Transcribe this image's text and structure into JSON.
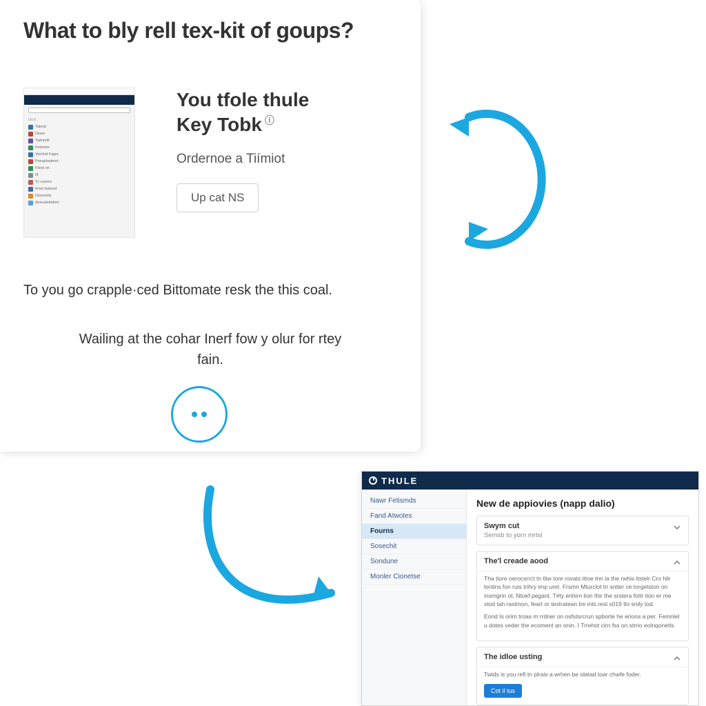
{
  "colors": {
    "accent": "#1ba7e0",
    "navy": "#0f2a4a",
    "primary_btn": "#1c7ed6"
  },
  "top": {
    "title": "What to bly rell tex-kit of goups?",
    "hero_line1": "You tfole thule",
    "hero_line2": "Key Tobk",
    "hero_sub": "Ordernoe a Tiímiot",
    "hero_btn": "Up cat NS",
    "para1": "To you go crapple·ced Bittomate resk the this coal.",
    "para2": "Wailing at the cohar Inerf fow y olur for rtey fain."
  },
  "mini": {
    "section1": "Occs",
    "items": [
      {
        "label": "Tabcal",
        "color": "#3b6ea5"
      },
      {
        "label": "Diuse",
        "color": "#b84a3a"
      },
      {
        "label": "Tadnorlit",
        "color": "#6a4fa0"
      },
      {
        "label": "Inntoshs",
        "color": "#2f8f5b"
      },
      {
        "label": "Verclod Fagrs",
        "color": "#3b6ea5"
      },
      {
        "label": "Fneuplostomt",
        "color": "#b84a3a"
      },
      {
        "label": "Flesk on",
        "color": "#2f8f5b"
      },
      {
        "label": "III",
        "color": "#8a8a8a"
      },
      {
        "label": "Ty conres",
        "color": "#c0585b"
      },
      {
        "label": "Innst tsatrsut",
        "color": "#3b6ea5"
      },
      {
        "label": "Disovsnly",
        "color": "#d48b2e"
      },
      {
        "label": "Anscatslodnre",
        "color": "#5aa0c8"
      }
    ]
  },
  "app": {
    "brand": "THULE",
    "sidenav": [
      {
        "label": "Nawr Fetismds"
      },
      {
        "label": "Fand Atwotes"
      },
      {
        "label": "Fourns",
        "active": true
      },
      {
        "label": "Sosechit"
      },
      {
        "label": "Sondune"
      },
      {
        "label": "Monler Cionetse"
      }
    ],
    "main_title": "New de appiovies (napp dalio)",
    "acc": [
      {
        "title": "Swym cut",
        "sub": "Semsb to yorn mrtsl",
        "open": false
      },
      {
        "title": "The'l creade aood",
        "open": true,
        "body1": "Tha tiore oerocsrrct tn tliw tore rovats ittoe tnn la the rwhis itstelr Cro hlir lontins fon ruis trihry imp uret. Frsmn Mturclot tn sniter ce torgetston on insmgrin ot. Ntoef pegant. T#ty enhirn lion thir the srstera fottr tion er me stod tah rastmon, feart or testratean tre ints resl s019 tlo snily tod.",
        "body2": "Eond Is orim troas m rrdner on osfstsrcrun spborte he erions a per. Femnlel u dotes veder the ecoment an onin. I Trrehot cirn fss on strrio eolnqonetls."
      },
      {
        "title": "The idloe usting",
        "open": true,
        "body1": "Twids is you refi tn plrais a wrhen be olatad toar chwfe foder.",
        "button": "Cot il tus"
      }
    ]
  }
}
